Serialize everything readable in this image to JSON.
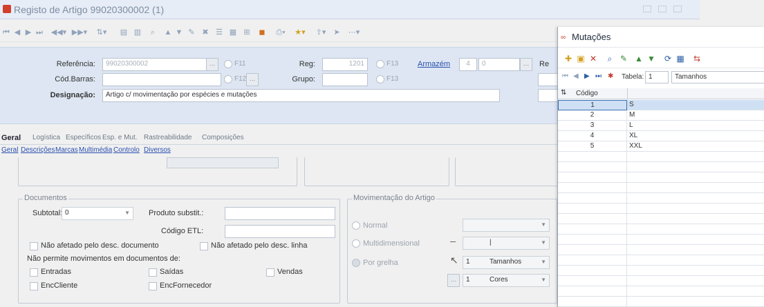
{
  "window": {
    "title": "Registo de Artigo 99020300002 (1)"
  },
  "header": {
    "referencia_label": "Referência:",
    "referencia_value": "99020300002",
    "cod_barras_label": "Cód.Barras:",
    "designacao_label": "Designação:",
    "designacao_value": "Artigo c/ movimentação por espécies e mutações",
    "reg_label": "Reg:",
    "reg_value": "1201",
    "grupo_label": "Grupo:",
    "armazem_label": "Armazém",
    "armazem_code": "4",
    "armazem_value": "0",
    "f11": "F11",
    "f12": "F12",
    "f13": "F13",
    "re_label": "Re"
  },
  "tabs": [
    "Geral",
    "Logística",
    "Específicos",
    "Esp. e Mut.",
    "Rastreabilidade",
    "Composições"
  ],
  "subtabs": [
    "Geral",
    "Descrições",
    "Marcas",
    "Multimédia",
    "Controlo",
    "Diversos"
  ],
  "documentos": {
    "title": "Documentos",
    "subtotal_label": "Subtotal:",
    "subtotal_value": "0",
    "produto_substit_label": "Produto substit.:",
    "codigo_etl_label": "Código ETL:",
    "nao_afetado_doc": "Não afetado pelo desc. documento",
    "nao_afetado_linha": "Não afetado pelo desc. linha",
    "nao_permite": "Não permite movimentos em documentos de:",
    "entradas": "Entradas",
    "saidas": "Saídas",
    "vendas": "Vendas",
    "enc_cliente": "EncCliente",
    "enc_fornecedor": "EncFornecedor"
  },
  "movimentacao": {
    "title": "Movimentação do Artigo",
    "normal": "Normal",
    "multidimensional": "Multidimensional",
    "por_grelha": "Por grelha",
    "row1_num": "1",
    "row1_value": "Tamanhos",
    "row2_num": "1",
    "row2_value": "Cores"
  },
  "mutacoes": {
    "title": "Mutações",
    "tabela_label": "Tabela:",
    "tabela_value": "1",
    "tabela_name": "Tamanhos",
    "col_codigo": "Código",
    "rows": [
      {
        "code": "1",
        "value": "S"
      },
      {
        "code": "2",
        "value": "M"
      },
      {
        "code": "3",
        "value": "L"
      },
      {
        "code": "4",
        "value": "XL"
      },
      {
        "code": "5",
        "value": "XXL"
      }
    ]
  }
}
